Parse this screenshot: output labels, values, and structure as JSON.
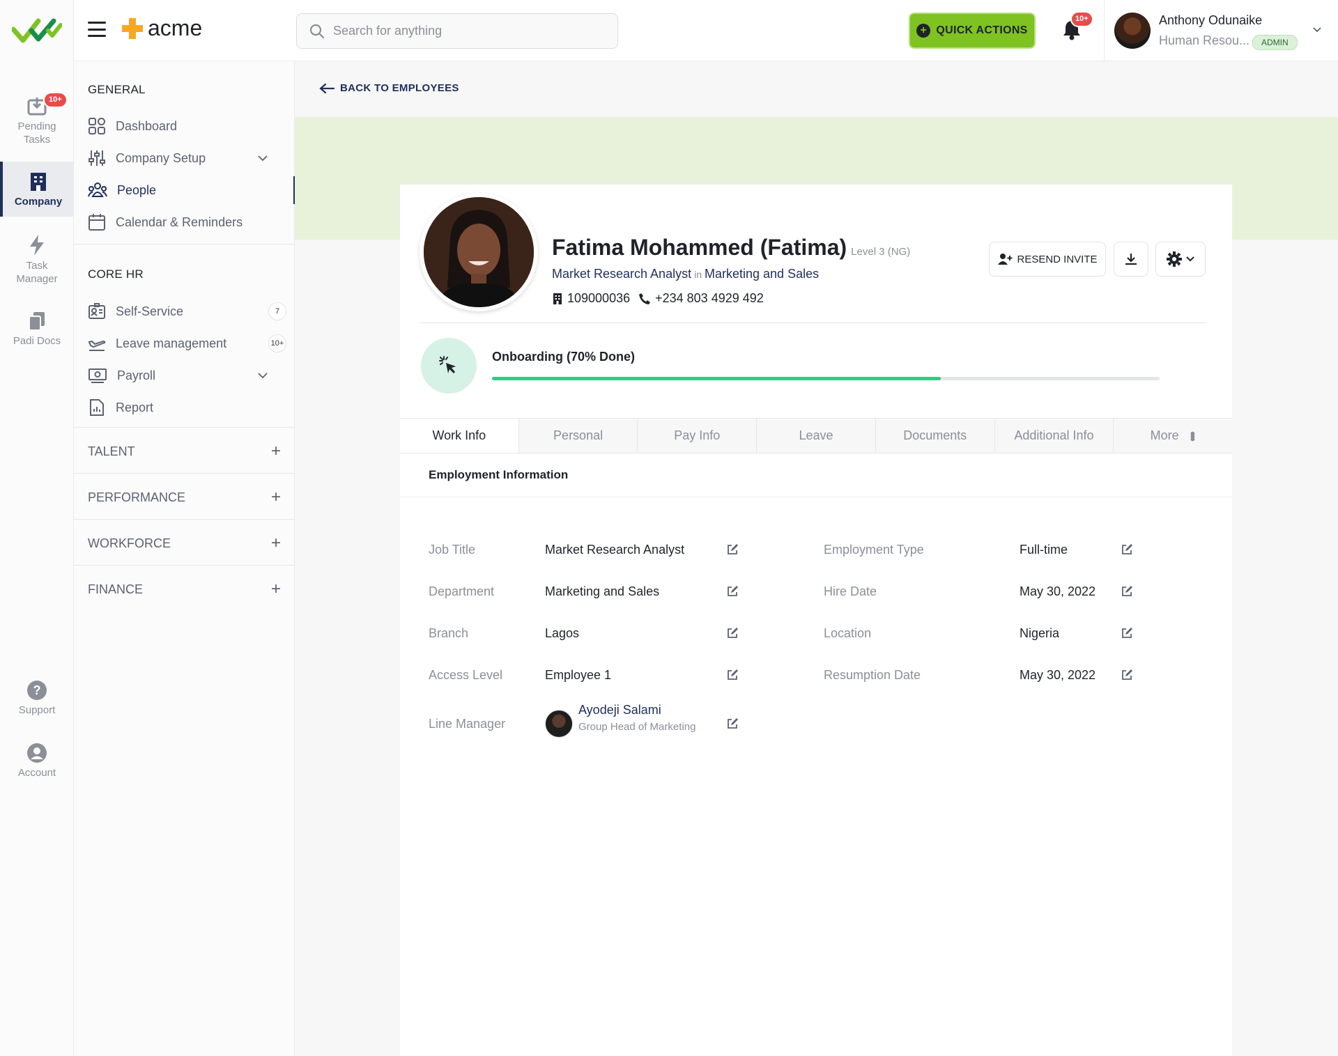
{
  "app": {
    "brand": "acme",
    "search_placeholder": "Search for anything",
    "quick_actions": "QUICK ACTIONS",
    "notif_badge": "10+"
  },
  "user": {
    "name": "Anthony Odunaike",
    "role": "Human Resou...",
    "badge": "ADMIN"
  },
  "rail": {
    "pending_tasks": "Pending Tasks",
    "pending_badge": "10+",
    "company": "Company",
    "task_manager": "Task Manager",
    "padi_docs": "Padi Docs",
    "support": "Support",
    "account": "Account"
  },
  "sidebar": {
    "general": "GENERAL",
    "dashboard": "Dashboard",
    "company_setup": "Company Setup",
    "people": "People",
    "calendar": "Calendar & Reminders",
    "core_hr": "CORE HR",
    "self_service": "Self-Service",
    "self_service_count": "7",
    "leave": "Leave management",
    "leave_count": "10+",
    "payroll": "Payroll",
    "report": "Report",
    "talent": "TALENT",
    "performance": "PERFORMANCE",
    "workforce": "WORKFORCE",
    "finance": "FINANCE"
  },
  "page": {
    "back": "BACK TO EMPLOYEES",
    "name": "Fatima Mohammed (Fatima)",
    "level": "Level 3 (NG)",
    "job": "Market Research Analyst",
    "in": "in",
    "dept": "Marketing and Sales",
    "emp_id": "109000036",
    "phone": "+234 803 4929 492",
    "resend": "RESEND INVITE",
    "onboarding": "Onboarding (70% Done)",
    "onboarding_progress": 0.672
  },
  "tabs": [
    "Work Info",
    "Personal",
    "Pay Info",
    "Leave",
    "Documents",
    "Additional Info",
    "More"
  ],
  "section": {
    "title": "Employment Information"
  },
  "fields_left": [
    {
      "label": "Job Title",
      "value": "Market Research Analyst"
    },
    {
      "label": "Department",
      "value": "Marketing and Sales"
    },
    {
      "label": "Branch",
      "value": "Lagos"
    },
    {
      "label": "Access Level",
      "value": "Employee 1"
    },
    {
      "label": "Line Manager",
      "value": "Ayodeji Salami",
      "sub": "Group Head of Marketing"
    }
  ],
  "fields_right": [
    {
      "label": "Employment Type",
      "value": "Full-time"
    },
    {
      "label": "Hire Date",
      "value": "May 30, 2022"
    },
    {
      "label": "Location",
      "value": "Nigeria"
    },
    {
      "label": "Resumption Date",
      "value": "May 30, 2022"
    }
  ]
}
